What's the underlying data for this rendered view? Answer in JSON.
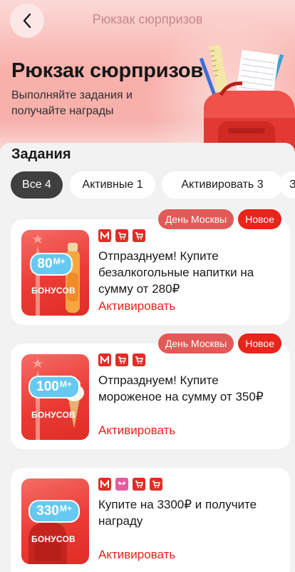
{
  "header": {
    "nav_title": "Рюкзак сюрпризов",
    "title": "Рюкзак сюрпризов",
    "subtitle": "Выполняйте задания и получайте награды"
  },
  "section_title": "Задания",
  "filters": [
    {
      "label": "Все 4",
      "active": true
    },
    {
      "label": "Активные 1",
      "active": false
    },
    {
      "label": "Активировать 3",
      "active": false
    },
    {
      "label": "З",
      "active": false
    }
  ],
  "tasks": [
    {
      "tags": [
        "День Москвы",
        "Новое"
      ],
      "badge_value": "80",
      "badge_unit": "М+",
      "thumb_label": "БОНУСОВ",
      "stores": [
        "m",
        "cart",
        "cart"
      ],
      "text": "Отпразднуем! Купите безалкогольные напитки на сумму от 280₽",
      "action": "Активировать"
    },
    {
      "tags": [
        "День Москвы",
        "Новое"
      ],
      "badge_value": "100",
      "badge_unit": "М+",
      "thumb_label": "БОНУСОВ",
      "stores": [
        "m",
        "cart",
        "cart"
      ],
      "text": "Отпразднуем! Купите мороженое на сумму от 350₽",
      "action": "Активировать"
    },
    {
      "tags": [],
      "badge_value": "330",
      "badge_unit": "М+",
      "thumb_label": "БОНУСОВ",
      "stores": [
        "m",
        "butterfly",
        "cart",
        "cart"
      ],
      "text": "Купите на 3300₽ и получите награду",
      "action": "Активировать"
    }
  ],
  "colors": {
    "accent_red": "#e4221a",
    "chip_active": "#3f3f40",
    "badge_blue": "#66c9f2"
  }
}
